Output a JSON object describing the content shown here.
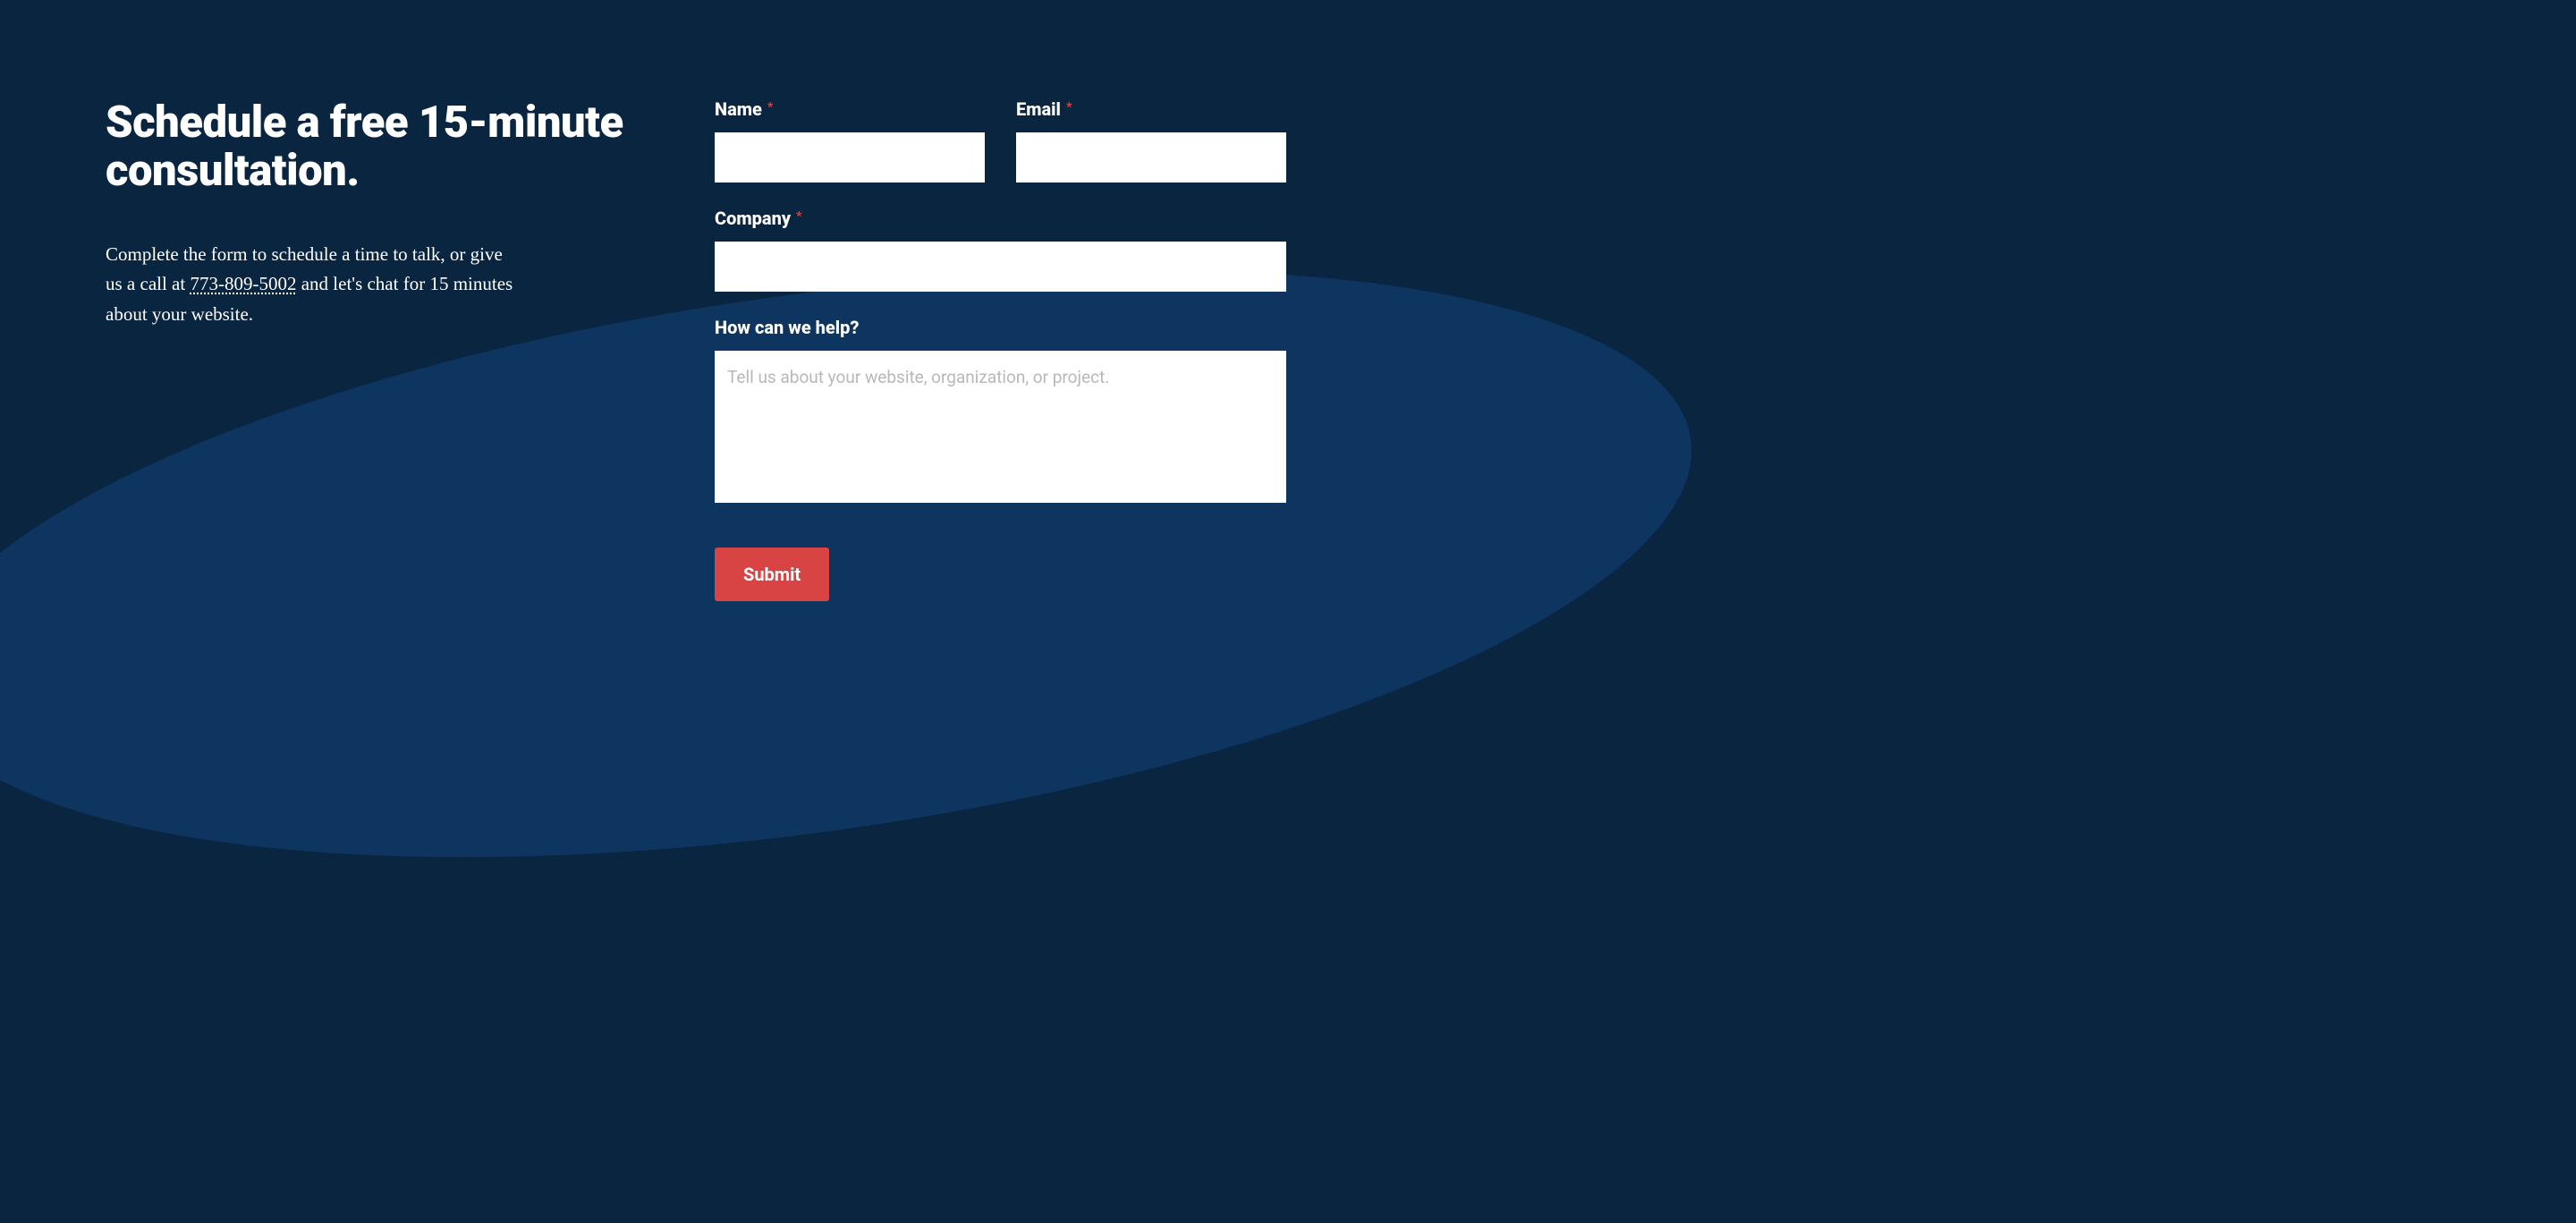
{
  "heading": "Schedule a free 15-minute consultation.",
  "description": {
    "prefix": "Complete the form to schedule a time to talk, or give us a call at ",
    "phone": "773-809-5002",
    "suffix": " and let's chat for 15 minutes about your website."
  },
  "form": {
    "name": {
      "label": "Name",
      "required": "*"
    },
    "email": {
      "label": "Email",
      "required": "*"
    },
    "company": {
      "label": "Company",
      "required": "*"
    },
    "message": {
      "label": "How can we help?",
      "placeholder": "Tell us about your website, organization, or project."
    },
    "submit": "Submit"
  }
}
